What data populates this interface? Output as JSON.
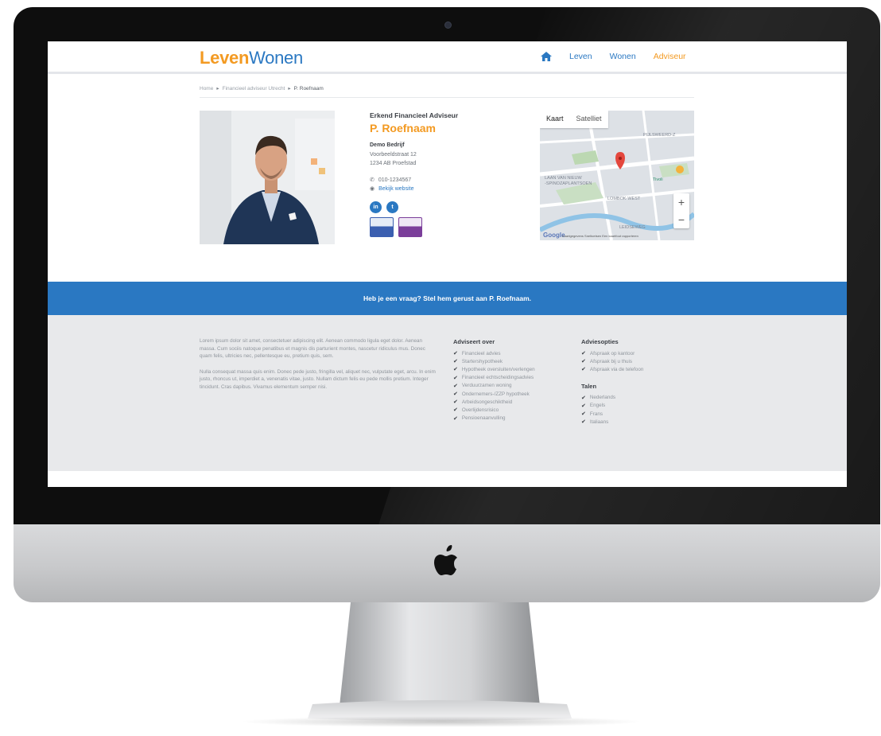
{
  "site": {
    "logo_part1": "Leven",
    "logo_part2": "Wonen",
    "nav": [
      "Leven",
      "Wonen",
      "Adviseur"
    ]
  },
  "breadcrumb": {
    "items": [
      "Home",
      "Financieel adviseur Utrecht",
      "P. Roefnaam"
    ]
  },
  "profile": {
    "role": "Erkend Financieel Adviseur",
    "name": "P. Roefnaam",
    "company": "Demo Bedrijf",
    "street": "Voorbeeldstraat 12",
    "city": "1234 AB Proefstad",
    "phone": "010-1234567",
    "website_label": "Bekijk website",
    "social": [
      "in",
      "t"
    ]
  },
  "map": {
    "tab_map": "Kaart",
    "tab_satellite": "Satelliet",
    "zoom_in": "+",
    "zoom_out": "−",
    "google": "Google",
    "attribution": "Kaartgegevens  Sneltoetsen  Een kaartfout rapporteren",
    "labels": [
      "PIJLSWEERD-Z",
      "LAAN VAN NIEUW",
      "-SPINOZAPLANTSOEN",
      "LOMBOK-WEST",
      "LEIDSEWEG",
      "Tivoli"
    ]
  },
  "cta": {
    "text": "Heb je een vraag? Stel hem gerust aan P. Roefnaam."
  },
  "about": {
    "p1": "Lorem ipsum dolor sit amet, consectetuer adipiscing elit. Aenean commodo ligula eget dolor. Aenean massa. Cum sociis natoque penatibus et magnis dis parturient montes, nascetur ridiculus mus. Donec quam felis, ultricies nec, pellentesque eu, pretium quis, sem.",
    "p2": "Nulla consequat massa quis enim. Donec pede justo, fringilla vel, aliquet nec, vulputate eget, arcu. In enim justo, rhoncus ut, imperdiet a, venenatis vitae, justo. Nullam dictum felis eu pede mollis pretium. Integer tincidunt. Cras dapibus. Vivamus elementum semper nisi."
  },
  "advises": {
    "title": "Adviseert over",
    "items": [
      "Financieel advies",
      "Startershypotheek",
      "Hypotheek oversluiten/verlengen",
      "Financieel echtscheidingsadvies",
      "Verduurzamen woning",
      "Ondernemers-/ZZP hypotheek",
      "Arbeidsongeschiktheid",
      "Overlijdensrisico",
      "Pensioenaanvulling"
    ]
  },
  "options": {
    "title": "Adviesopties",
    "items": [
      "Afspraak op kantoor",
      "Afspraak bij u thuis",
      "Afspraak via de telefoon"
    ]
  },
  "languages": {
    "title": "Talen",
    "items": [
      "Nederlands",
      "Engels",
      "Frans",
      "Italiaans"
    ]
  },
  "colors": {
    "brand_orange": "#f39a22",
    "brand_blue": "#2a78c2",
    "grey_band": "#e8e9eb"
  }
}
